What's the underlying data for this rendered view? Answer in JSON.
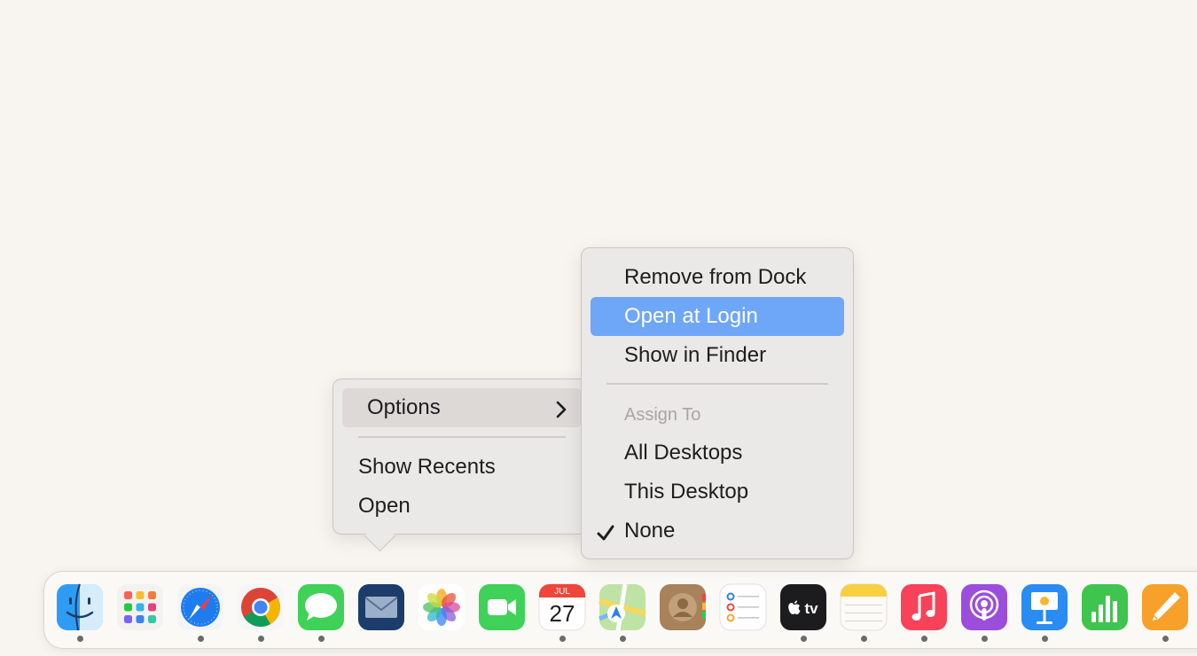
{
  "main_menu": {
    "options_label": "Options",
    "show_recents_label": "Show Recents",
    "open_label": "Open"
  },
  "options_submenu": {
    "remove_from_dock": "Remove from Dock",
    "open_at_login": "Open at Login",
    "show_in_finder": "Show in Finder",
    "assign_to_header": "Assign To",
    "all_desktops": "All Desktops",
    "this_desktop": "This Desktop",
    "none": "None",
    "checked_item": "None"
  },
  "dock": {
    "apps": [
      {
        "name": "Finder",
        "icon": "finder-icon",
        "running": true
      },
      {
        "name": "Launchpad",
        "icon": "launchpad-icon",
        "running": false
      },
      {
        "name": "Safari",
        "icon": "safari-icon",
        "running": true
      },
      {
        "name": "Google Chrome",
        "icon": "chrome-icon",
        "running": true
      },
      {
        "name": "Messages",
        "icon": "messages-icon",
        "running": true
      },
      {
        "name": "Mail",
        "icon": "mail-icon",
        "running": false
      },
      {
        "name": "Photos",
        "icon": "photos-icon",
        "running": false
      },
      {
        "name": "FaceTime",
        "icon": "facetime-icon",
        "running": false
      },
      {
        "name": "Calendar",
        "icon": "calendar-icon",
        "running": true
      },
      {
        "name": "Maps",
        "icon": "maps-icon",
        "running": true
      },
      {
        "name": "Contacts",
        "icon": "contacts-icon",
        "running": false
      },
      {
        "name": "Reminders",
        "icon": "reminders-icon",
        "running": false
      },
      {
        "name": "TV",
        "icon": "appletv-icon",
        "running": true
      },
      {
        "name": "Notes",
        "icon": "notes-icon",
        "running": true
      },
      {
        "name": "Music",
        "icon": "music-icon",
        "running": true
      },
      {
        "name": "Podcasts",
        "icon": "podcasts-icon",
        "running": true
      },
      {
        "name": "Keynote",
        "icon": "keynote-icon",
        "running": true
      },
      {
        "name": "Numbers",
        "icon": "numbers-icon",
        "running": false
      },
      {
        "name": "Pages",
        "icon": "pages-icon",
        "running": true
      }
    ],
    "calendar_month": "JUL",
    "calendar_day": "27",
    "tv_label": "tv"
  },
  "colors": {
    "selected_highlight": "#6ea6f8",
    "menu_background": "#ebe9e7",
    "desktop_background": "#f8f5f0"
  }
}
